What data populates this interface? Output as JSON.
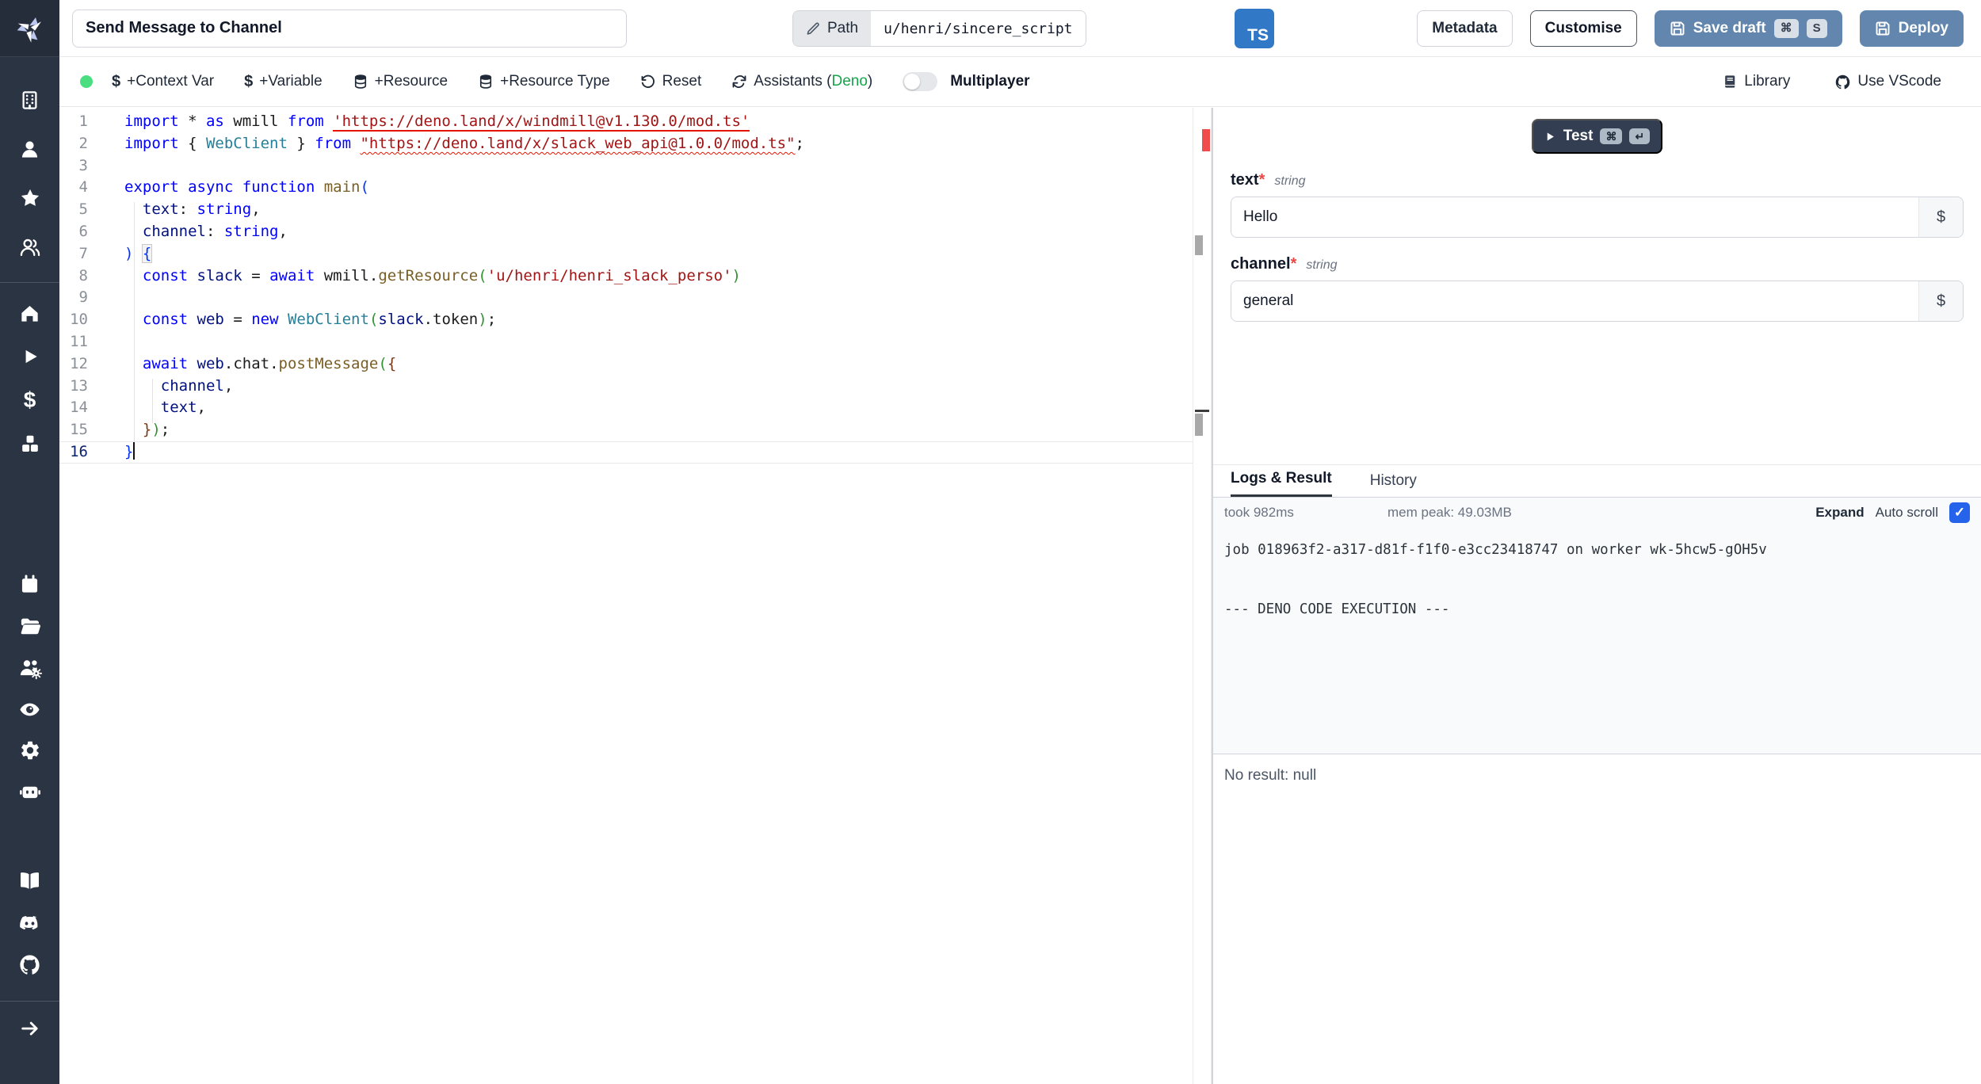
{
  "window": {
    "title_input": "Send Message to Channel"
  },
  "topbar": {
    "path_label": "Path",
    "path_value": "u/henri/sincere_script",
    "lang_badge": "TS",
    "metadata_button": "Metadata",
    "customise_button": "Customise",
    "save_draft_button": "Save draft",
    "save_draft_kbd": [
      "⌘",
      "S"
    ],
    "deploy_button": "Deploy"
  },
  "toolbar": {
    "context_var": "+Context Var",
    "variable": "+Variable",
    "resource": "+Resource",
    "resource_type": "+Resource Type",
    "reset": "Reset",
    "assistants_prefix": "Assistants (",
    "assistants_lang": "Deno",
    "assistants_suffix": ")",
    "multiplayer": "Multiplayer",
    "library": "Library",
    "use_vscode": "Use VScode",
    "dollar_glyph": "$"
  },
  "sidebar": {
    "icons": [
      "windmill-logo",
      "building-icon",
      "user-icon",
      "star-icon",
      "users-icon",
      "home-icon",
      "play-icon",
      "dollar-icon",
      "cubes-icon",
      "calendar-icon",
      "folder-icon",
      "user-group-gear-icon",
      "eye-icon",
      "gear-icon",
      "robot-icon",
      "book-icon",
      "discord-icon",
      "github-icon",
      "arrow-right-icon"
    ],
    "dollar_glyph": "$"
  },
  "editor": {
    "lines": [
      {
        "n": "1",
        "tokens": [
          {
            "t": "import",
            "c": "kw"
          },
          {
            "t": " * ",
            "c": "plain"
          },
          {
            "t": "as",
            "c": "kw"
          },
          {
            "t": " wmill ",
            "c": "plain"
          },
          {
            "t": "from",
            "c": "kw"
          },
          {
            "t": " ",
            "c": "plain"
          },
          {
            "t": "'https://deno.land/x/windmill@v1.130.0/mod.ts'",
            "c": "strU"
          }
        ]
      },
      {
        "n": "2",
        "tokens": [
          {
            "t": "import",
            "c": "kw"
          },
          {
            "t": " { ",
            "c": "plain"
          },
          {
            "t": "WebClient",
            "c": "type"
          },
          {
            "t": " } ",
            "c": "plain"
          },
          {
            "t": "from",
            "c": "kw"
          },
          {
            "t": " ",
            "c": "plain"
          },
          {
            "t": "\"https://deno.land/x/slack_web_api@1.0.0/mod.ts\"",
            "c": "strW"
          },
          {
            "t": ";",
            "c": "plain"
          }
        ]
      },
      {
        "n": "3",
        "tokens": []
      },
      {
        "n": "4",
        "tokens": [
          {
            "t": "export",
            "c": "kw"
          },
          {
            "t": " ",
            "c": "plain"
          },
          {
            "t": "async",
            "c": "kw"
          },
          {
            "t": " ",
            "c": "plain"
          },
          {
            "t": "function",
            "c": "kw"
          },
          {
            "t": " ",
            "c": "plain"
          },
          {
            "t": "main",
            "c": "fn"
          },
          {
            "t": "(",
            "c": "b1"
          }
        ]
      },
      {
        "n": "5",
        "tokens": [
          {
            "t": "  ",
            "c": "plain"
          },
          {
            "t": "text",
            "c": "var"
          },
          {
            "t": ": ",
            "c": "plain"
          },
          {
            "t": "string",
            "c": "kw"
          },
          {
            "t": ",",
            "c": "plain"
          }
        ]
      },
      {
        "n": "6",
        "tokens": [
          {
            "t": "  ",
            "c": "plain"
          },
          {
            "t": "channel",
            "c": "var"
          },
          {
            "t": ": ",
            "c": "plain"
          },
          {
            "t": "string",
            "c": "kw"
          },
          {
            "t": ",",
            "c": "plain"
          }
        ]
      },
      {
        "n": "7",
        "tokens": [
          {
            "t": ")",
            "c": "b1"
          },
          {
            "t": " ",
            "c": "plain"
          },
          {
            "t": "{",
            "c": "b1m"
          }
        ]
      },
      {
        "n": "8",
        "tokens": [
          {
            "t": "  ",
            "c": "plain"
          },
          {
            "t": "const",
            "c": "kw"
          },
          {
            "t": " ",
            "c": "plain"
          },
          {
            "t": "slack",
            "c": "var"
          },
          {
            "t": " = ",
            "c": "plain"
          },
          {
            "t": "await",
            "c": "kw"
          },
          {
            "t": " wmill.",
            "c": "plain"
          },
          {
            "t": "getResource",
            "c": "fn"
          },
          {
            "t": "(",
            "c": "b2"
          },
          {
            "t": "'u/henri/henri_slack_perso'",
            "c": "str"
          },
          {
            "t": ")",
            "c": "b2"
          }
        ]
      },
      {
        "n": "9",
        "tokens": []
      },
      {
        "n": "10",
        "tokens": [
          {
            "t": "  ",
            "c": "plain"
          },
          {
            "t": "const",
            "c": "kw"
          },
          {
            "t": " ",
            "c": "plain"
          },
          {
            "t": "web",
            "c": "var"
          },
          {
            "t": " = ",
            "c": "plain"
          },
          {
            "t": "new",
            "c": "kw"
          },
          {
            "t": " ",
            "c": "plain"
          },
          {
            "t": "WebClient",
            "c": "type"
          },
          {
            "t": "(",
            "c": "b2"
          },
          {
            "t": "slack",
            "c": "var"
          },
          {
            "t": ".token",
            "c": "plain"
          },
          {
            "t": ")",
            "c": "b2"
          },
          {
            "t": ";",
            "c": "plain"
          }
        ]
      },
      {
        "n": "11",
        "tokens": []
      },
      {
        "n": "12",
        "tokens": [
          {
            "t": "  ",
            "c": "plain"
          },
          {
            "t": "await",
            "c": "kw"
          },
          {
            "t": " ",
            "c": "plain"
          },
          {
            "t": "web",
            "c": "var"
          },
          {
            "t": ".chat.",
            "c": "plain"
          },
          {
            "t": "postMessage",
            "c": "fn"
          },
          {
            "t": "(",
            "c": "b2"
          },
          {
            "t": "{",
            "c": "b3"
          }
        ]
      },
      {
        "n": "13",
        "tokens": [
          {
            "t": "    ",
            "c": "plain"
          },
          {
            "t": "channel",
            "c": "var"
          },
          {
            "t": ",",
            "c": "plain"
          }
        ]
      },
      {
        "n": "14",
        "tokens": [
          {
            "t": "    ",
            "c": "plain"
          },
          {
            "t": "text",
            "c": "var"
          },
          {
            "t": ",",
            "c": "plain"
          }
        ]
      },
      {
        "n": "15",
        "tokens": [
          {
            "t": "  ",
            "c": "plain"
          },
          {
            "t": "}",
            "c": "b3"
          },
          {
            "t": ")",
            "c": "b2"
          },
          {
            "t": ";",
            "c": "plain"
          }
        ]
      },
      {
        "n": "16",
        "tokens": [
          {
            "t": "}",
            "c": "b1"
          }
        ],
        "cursor": true,
        "active": true
      }
    ]
  },
  "run_panel": {
    "test_button": "Test",
    "test_kbd": [
      "⌘",
      "↵"
    ],
    "fields": [
      {
        "name": "text",
        "required": "*",
        "type": "string",
        "value": "Hello",
        "suffix": "$"
      },
      {
        "name": "channel",
        "required": "*",
        "type": "string",
        "value": "general",
        "suffix": "$"
      }
    ],
    "tabs": {
      "logs": "Logs & Result",
      "history": "History"
    },
    "status": {
      "took": "took 982ms",
      "mem": "mem peak: 49.03MB",
      "expand": "Expand",
      "autoscroll": "Auto scroll",
      "autoscroll_check": "✓"
    },
    "logs": "job 018963f2-a317-d81f-f1f0-e3cc23418747 on worker wk-5hcw5-gOH5v\n\n\n--- DENO CODE EXECUTION ---",
    "result": "No result: null"
  },
  "colors": {
    "sidebar_bg": "#2b3442",
    "ts_badge": "#3178c6",
    "deno_green": "#16a34a",
    "status_dot_green": "#4ade80",
    "primary_button_blue": "#6286ae",
    "checkbox_blue": "#2563eb",
    "diagnostic_red": "#f14c4c"
  }
}
